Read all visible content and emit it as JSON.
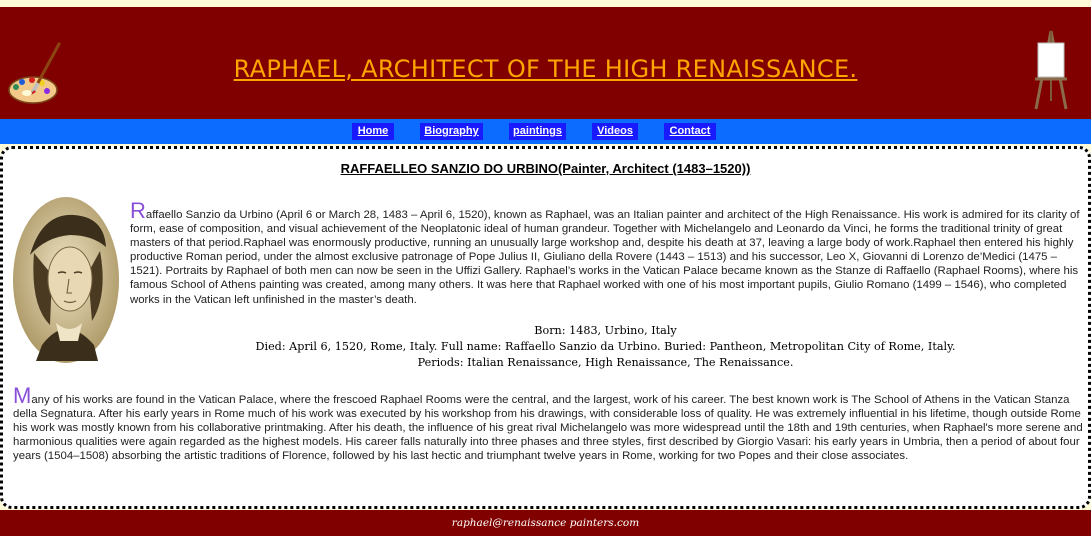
{
  "header": {
    "title": "RAPHAEL, ARCHITECT OF THE HIGH RENAISSANCE.",
    "logo_icon": "palette-icon",
    "easel_icon": "easel-icon"
  },
  "nav": {
    "items": [
      {
        "label": "Home"
      },
      {
        "label": "Biography"
      },
      {
        "label": "paintings"
      },
      {
        "label": "Videos"
      },
      {
        "label": "Contact"
      }
    ]
  },
  "content": {
    "heading": "RAFFAELLEO SANZIO DO URBINO(Painter, Architect (1483–1520))",
    "paragraph1": {
      "dropcap": "R",
      "text": "affaello Sanzio da Urbino (April 6 or March 28, 1483 – April 6, 1520), known as Raphael, was an Italian painter and architect of the High Renaissance. His work is admired for its clarity of form, ease of composition, and visual achievement of the Neoplatonic ideal of human grandeur. Together with Michelangelo and Leonardo da Vinci, he forms the traditional trinity of great masters of that period.Raphael was enormously productive, running an unusually large workshop and, despite his death at 37, leaving a large body of work.Raphael then entered his highly productive Roman period, under the almost exclusive patronage of Pope Julius II, Giuliano della Rovere (1443 – 1513) and his successor, Leo X, Giovanni di Lorenzo de’Medici (1475 – 1521). Portraits by Raphael of both men can now be seen in the Uffizi Gallery. Raphael’s works in the Vatican Palace became known as the Stanze di Raffaello (Raphael Rooms), where his famous School of Athens painting was created, among many others. It was here that Raphael worked with one of his most important pupils, Giulio Romano (1499 – 1546), who completed works in the Vatican left unfinished in the master’s death."
    },
    "facts": {
      "born": "Born: 1483, Urbino, Italy",
      "died": "Died: April 6, 1520, Rome, Italy. Full name: Raffaello Sanzio da Urbino. Buried: Pantheon, Metropolitan City of Rome, Italy.",
      "periods": "Periods: Italian Renaissance, High Renaissance, The Renaissance."
    },
    "paragraph2": {
      "dropcap": "M",
      "text": "any of his works are found in the Vatican Palace, where the frescoed Raphael Rooms were the central, and the largest, work of his career. The best known work is The School of Athens in the Vatican Stanza della Segnatura. After his early years in Rome much of his work was executed by his workshop from his drawings, with considerable loss of quality. He was extremely influential in his lifetime, though outside Rome his work was mostly known from his collaborative printmaking. After his death, the influence of his great rival Michelangelo was more widespread until the 18th and 19th centuries, when Raphael's more serene and harmonious qualities were again regarded as the highest models. His career falls naturally into three phases and three styles, first described by Giorgio Vasari: his early years in Umbria, then a period of about four years (1504–1508) absorbing the artistic traditions of Florence, followed by his last hectic and triumphant twelve years in Rome, working for two Popes and their close associates."
    },
    "portrait_image": "raphael-portrait"
  },
  "footer": {
    "email": "raphael@renaissance painters.com"
  },
  "colors": {
    "header_bg": "#800000",
    "title": "#ffa500",
    "nav_bar": "#0b6cff",
    "nav_button": "#1a1aff",
    "dropcap": "#8a4fd8",
    "page_bg": "#fffbd6"
  }
}
